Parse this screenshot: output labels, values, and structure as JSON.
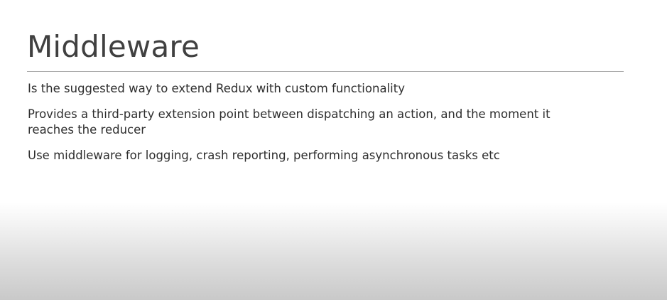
{
  "slide": {
    "title": "Middleware",
    "bullets": [
      "Is the suggested way to extend Redux with custom functionality",
      "Provides a third-party extension point between dispatching an action, and the moment it reaches the reducer",
      "Use middleware for logging, crash reporting, performing asynchronous tasks etc"
    ]
  }
}
